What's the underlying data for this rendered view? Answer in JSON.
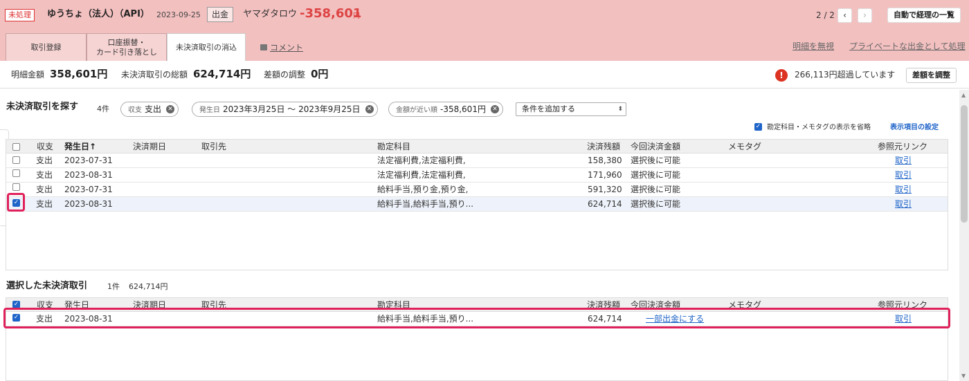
{
  "header": {
    "status_badge": "未処理",
    "company": "ゆうちょ（法人）（API）",
    "date": "2023-09-25",
    "direction_badge": "出金",
    "partner": "ヤマダタロウ",
    "amount": "-358,601",
    "amount_unit": "円",
    "pager": "2 / 2",
    "prev_icon": "‹",
    "next_icon": "›",
    "list_button": "自動で経理の一覧",
    "tabs": [
      {
        "label": "取引登録"
      },
      {
        "label_line1": "口座振替・",
        "label_line2": "カード引き落とし"
      },
      {
        "label": "未決済取引の消込"
      }
    ],
    "comment_link": "コメント",
    "ignore_link": "明細を無視",
    "private_link": "プライベートな出金として処理"
  },
  "summary": {
    "detail_label": "明細金額",
    "detail_value": "358,601円",
    "total_label": "未決済取引の総額",
    "total_value": "624,714円",
    "diff_label": "差額の調整",
    "diff_value": "0円",
    "warn_icon": "!",
    "warn_text": "266,113円超過しています",
    "adjust_button": "差額を調整"
  },
  "search": {
    "title": "未決済取引を探す",
    "count": "4件",
    "chips": [
      {
        "label": "収支",
        "value": "支出"
      },
      {
        "label": "発生日",
        "value": "2023年3月25日 〜 2023年9月25日"
      },
      {
        "label": "金額が近い順",
        "value": "-358,601円"
      }
    ],
    "chip_close": "✕",
    "add_condition": "条件を追加する",
    "add_condition_arrow": "⬍",
    "omit_label": "勘定科目・メモタグの表示を省略",
    "display_settings": "表示項目の設定"
  },
  "columns": {
    "kind": "収支",
    "date": "発生日",
    "sort_icon": "↑",
    "due": "決済期日",
    "partner": "取引先",
    "account": "勘定科目",
    "balance": "決済残額",
    "this_amount": "今回決済金額",
    "memo": "メモタグ",
    "ref": "参照元リンク"
  },
  "search_rows": [
    {
      "kind": "支出",
      "date": "2023-07-31",
      "account": "法定福利費,法定福利費,",
      "balance": "158,380",
      "this_amount": "選択後に可能",
      "ref": "取引",
      "checked": false
    },
    {
      "kind": "支出",
      "date": "2023-08-31",
      "account": "法定福利費,法定福利費,",
      "balance": "171,960",
      "this_amount": "選択後に可能",
      "ref": "取引",
      "checked": false
    },
    {
      "kind": "支出",
      "date": "2023-07-31",
      "account": "給料手当,預り金,預り金,",
      "balance": "591,320",
      "this_amount": "選択後に可能",
      "ref": "取引",
      "checked": false
    },
    {
      "kind": "支出",
      "date": "2023-08-31",
      "account": "給料手当,給料手当,預り...",
      "balance": "624,714",
      "this_amount": "選択後に可能",
      "ref": "取引",
      "checked": true
    }
  ],
  "selected": {
    "title": "選択した未決済取引",
    "count": "1件",
    "total": "624,714円",
    "rows": [
      {
        "kind": "支出",
        "date": "2023-08-31",
        "account": "給料手当,給料手当,預り...",
        "balance": "624,714",
        "this_amount": "一部出金にする",
        "ref": "取引",
        "checked": true
      }
    ]
  },
  "check_mark": "✓",
  "scroll_up": "▲",
  "scroll_down": "▼",
  "colors": {
    "header_bg": "#f3c0c0",
    "amount": "#dd4444",
    "link": "#1f64c8",
    "highlight": "#e0205a",
    "warn": "#dd3322"
  }
}
